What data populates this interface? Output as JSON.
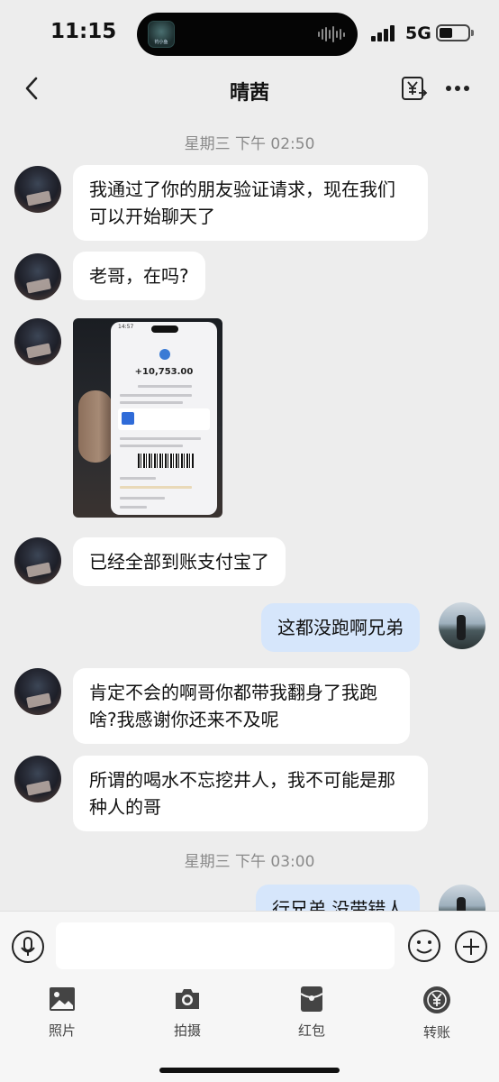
{
  "status_bar": {
    "time": "11:15",
    "network": "5G",
    "island_thumb_text": "钓小鱼"
  },
  "nav": {
    "title": "晴茜",
    "back_icon": "chevron-left-icon",
    "transfer_icon": "yuan-transfer-icon",
    "more_icon": "more-dots-icon"
  },
  "chat": {
    "timestamp_1": "星期三 下午 02:50",
    "timestamp_2": "星期三 下午 03:00",
    "messages": [
      {
        "side": "left",
        "text": "我通过了你的朋友验证请求，现在我们可以开始聊天了"
      },
      {
        "side": "left",
        "text": "老哥，在吗?"
      },
      {
        "side": "left",
        "type": "image",
        "screenshot_amount": "+10,753.00"
      },
      {
        "side": "left",
        "text": "已经全部到账支付宝了"
      },
      {
        "side": "right",
        "text": "这都没跑啊兄弟"
      },
      {
        "side": "left",
        "text": "肯定不会的啊哥你都带我翻身了我跑啥?我感谢你还来不及呢"
      },
      {
        "side": "left",
        "text": "所谓的喝水不忘挖井人，我不可能是那种人的哥"
      },
      {
        "side": "right",
        "text": "行兄弟 没带错人"
      }
    ]
  },
  "input_bar": {
    "placeholder": ""
  },
  "toolbar": {
    "items": [
      {
        "label": "照片",
        "icon": "photo-icon"
      },
      {
        "label": "拍摄",
        "icon": "camera-icon"
      },
      {
        "label": "红包",
        "icon": "red-packet-icon"
      },
      {
        "label": "转账",
        "icon": "transfer-icon"
      }
    ]
  },
  "colors": {
    "background": "#ededed",
    "bubble_left": "#ffffff",
    "bubble_right": "#d6e6fb",
    "timestamp": "#8a8a8a"
  }
}
